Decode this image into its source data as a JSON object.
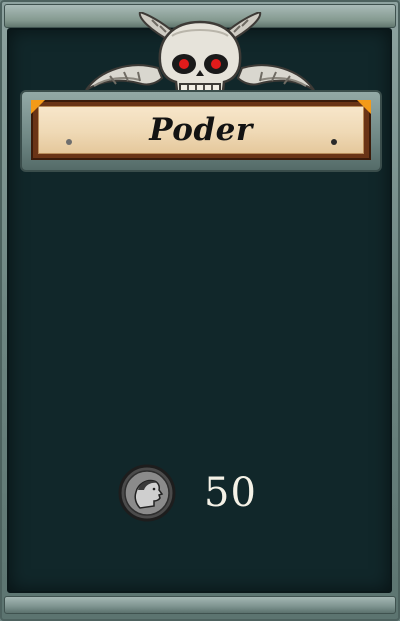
{
  "card": {
    "title": "Poder",
    "cost": {
      "value": "50",
      "icon": "coin-profile-icon"
    },
    "emblem": "horned-skull-icon"
  },
  "colors": {
    "panel": "#11272a",
    "frame": "#7d938f",
    "paper": "#f0dcba",
    "wood": "#6a3416",
    "accent": "#f39a18",
    "skull_eyes": "#e01b1b",
    "text_dark": "#131313",
    "text_light": "#f4f1e6"
  }
}
